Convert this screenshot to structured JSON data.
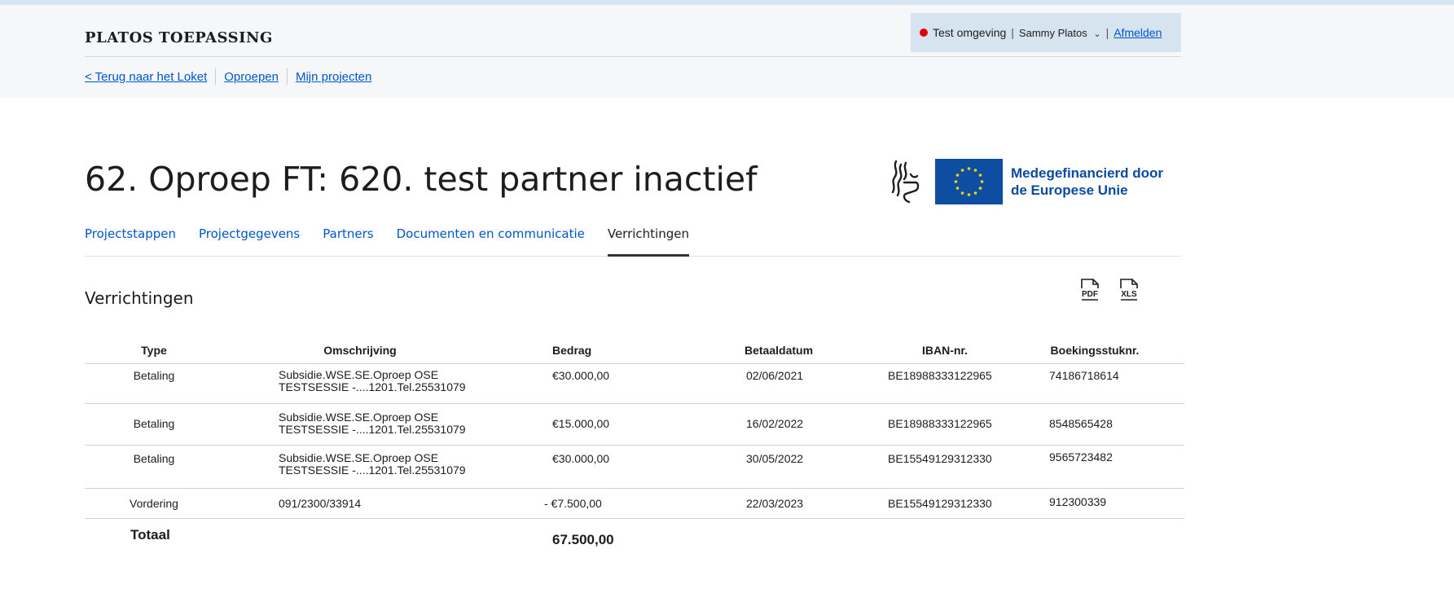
{
  "header": {
    "app_title": "PLATOS TOEPASSING",
    "environment": "Test omgeving",
    "user_name": "Sammy Platos",
    "logout": "Afmelden",
    "env_color": "#e00000"
  },
  "topnav": {
    "back": "< Terug naar het Loket",
    "calls": "Oproepen",
    "projects": "Mijn projecten"
  },
  "page_title": "62. Oproep FT: 620. test partner inactief",
  "eu_logo": {
    "line1": "Medegefinancierd door",
    "line2": "de Europese Unie"
  },
  "tabs": [
    {
      "label": "Projectstappen",
      "active": false
    },
    {
      "label": "Projectgegevens",
      "active": false
    },
    {
      "label": "Partners",
      "active": false
    },
    {
      "label": "Documenten en communicatie",
      "active": false
    },
    {
      "label": "Verrichtingen",
      "active": true
    }
  ],
  "section": {
    "title": "Verrichtingen",
    "export_pdf": "PDF",
    "export_xls": "XLS"
  },
  "table": {
    "headers": [
      "Type",
      "Omschrijving",
      "Bedrag",
      "Betaaldatum",
      "IBAN-nr.",
      "Boekingsstuknr."
    ],
    "rows": [
      {
        "type": "Betaling",
        "desc1": "Subsidie.WSE.SE.Oproep OSE",
        "desc2": "TESTSESSIE -....1201.Tel.25531079",
        "amount": "€30.000,00",
        "date": "02/06/2021",
        "iban": "BE18988333122965",
        "boek": "74186718614"
      },
      {
        "type": "Betaling",
        "desc1": "Subsidie.WSE.SE.Oproep OSE",
        "desc2": "TESTSESSIE -....1201.Tel.25531079",
        "amount": "€15.000,00",
        "date": "16/02/2022",
        "iban": "BE18988333122965",
        "boek": "8548565428"
      },
      {
        "type": "Betaling",
        "desc1": "Subsidie.WSE.SE.Oproep OSE",
        "desc2": "TESTSESSIE -....1201.Tel.25531079",
        "amount": "€30.000,00",
        "date": "30/05/2022",
        "iban": "BE15549129312330",
        "boek": "9565723482"
      },
      {
        "type": "Vordering",
        "desc1": "091/2300/33914",
        "desc2": "",
        "amount": "- €7.500,00",
        "date": "22/03/2023",
        "iban": "BE15549129312330",
        "boek": "912300339"
      }
    ],
    "total_label": "Totaal",
    "total_value": "67.500,00"
  },
  "colors": {
    "link": "#0055cc",
    "header_bg": "#f6f7f9",
    "user_box_bg": "#d6e4f0",
    "eu_blue": "#0d4ea3"
  }
}
